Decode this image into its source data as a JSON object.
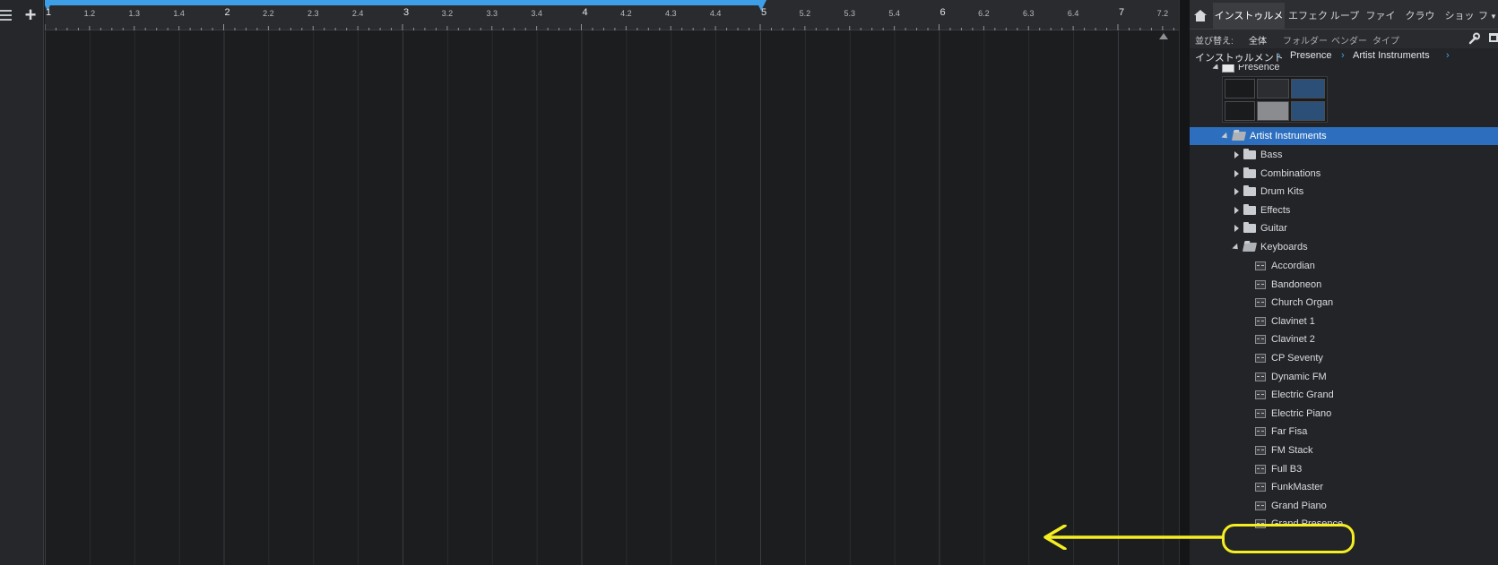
{
  "timeline": {
    "ruler_ticks": [
      {
        "label": "1",
        "major": true
      },
      {
        "label": "1.2",
        "major": false
      },
      {
        "label": "1.3",
        "major": false
      },
      {
        "label": "1.4",
        "major": false
      },
      {
        "label": "2",
        "major": true
      },
      {
        "label": "2.2",
        "major": false
      },
      {
        "label": "2.3",
        "major": false
      },
      {
        "label": "2.4",
        "major": false
      },
      {
        "label": "3",
        "major": true
      },
      {
        "label": "3.2",
        "major": false
      },
      {
        "label": "3.3",
        "major": false
      },
      {
        "label": "3.4",
        "major": false
      },
      {
        "label": "4",
        "major": true
      },
      {
        "label": "4.2",
        "major": false
      },
      {
        "label": "4.3",
        "major": false
      },
      {
        "label": "4.4",
        "major": false
      },
      {
        "label": "5",
        "major": true
      },
      {
        "label": "5.2",
        "major": false
      },
      {
        "label": "5.3",
        "major": false
      },
      {
        "label": "5.4",
        "major": false
      },
      {
        "label": "6",
        "major": true
      },
      {
        "label": "6.2",
        "major": false
      },
      {
        "label": "6.3",
        "major": false
      },
      {
        "label": "6.4",
        "major": false
      },
      {
        "label": "7",
        "major": true
      },
      {
        "label": "7.2",
        "major": false
      }
    ],
    "loop_color": "#3e9ee6"
  },
  "browser": {
    "tabs": [
      "インストゥルメント",
      "エフェクト",
      "ループ",
      "ファイル",
      "クラウド",
      "ショップ",
      "フ"
    ],
    "filter": {
      "sort_label": "並び替え:",
      "options": [
        "全体",
        "フォルダー",
        "ベンダー",
        "タイプ"
      ]
    },
    "breadcrumb": [
      "インストゥルメント",
      "Presence",
      "Artist Instruments"
    ],
    "tree": {
      "root": "Presence",
      "selected_folder": "Artist Instruments",
      "folders": [
        "Bass",
        "Combinations",
        "Drum Kits",
        "Effects",
        "Guitar"
      ],
      "open_folder": "Keyboards",
      "presets": [
        "Accordian",
        "Bandoneon",
        "Church Organ",
        "Clavinet 1",
        "Clavinet 2",
        "CP Seventy",
        "Dynamic FM",
        "Electric Grand",
        "Electric Piano",
        "Far Fisa",
        "FM Stack",
        "Full B3",
        "FunkMaster",
        "Grand Piano",
        "Grand Presence"
      ]
    },
    "highlighted_preset": "Grand Piano",
    "selection_color": "#2d6fbe"
  },
  "annotation": {
    "color": "#f5ee22"
  }
}
